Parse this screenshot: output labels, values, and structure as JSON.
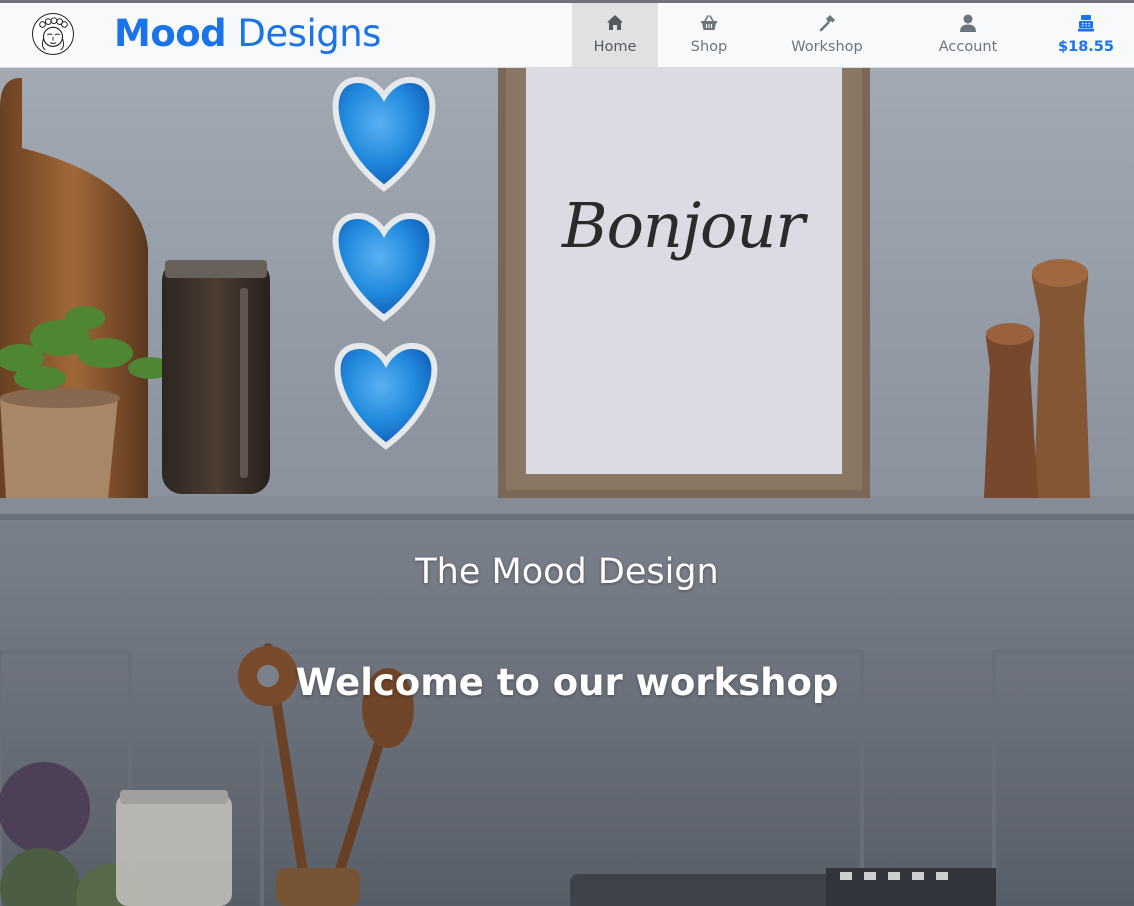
{
  "brand": {
    "name_bold": "Mood",
    "name_rest": "Designs",
    "logo_icon": "face-logo-icon"
  },
  "nav": {
    "items": [
      {
        "label": "Home",
        "icon": "home-icon",
        "active": true
      },
      {
        "label": "Shop",
        "icon": "basket-icon",
        "active": false
      },
      {
        "label": "Workshop",
        "icon": "hammer-icon",
        "active": false
      },
      {
        "label": "Account",
        "icon": "user-icon",
        "active": false
      }
    ],
    "cart": {
      "label": "$18.55",
      "icon": "cash-register-icon"
    }
  },
  "hero": {
    "title": "The Mood Design",
    "subtitle": "Welcome to our workshop",
    "frame_text": "Bonjour"
  },
  "colors": {
    "brand_blue": "#1a73e8",
    "nav_text": "#6c757d",
    "nav_active_bg": "#dfe1e3",
    "wall": "#9aa1ab",
    "heart_blue": "#1e90e8"
  }
}
